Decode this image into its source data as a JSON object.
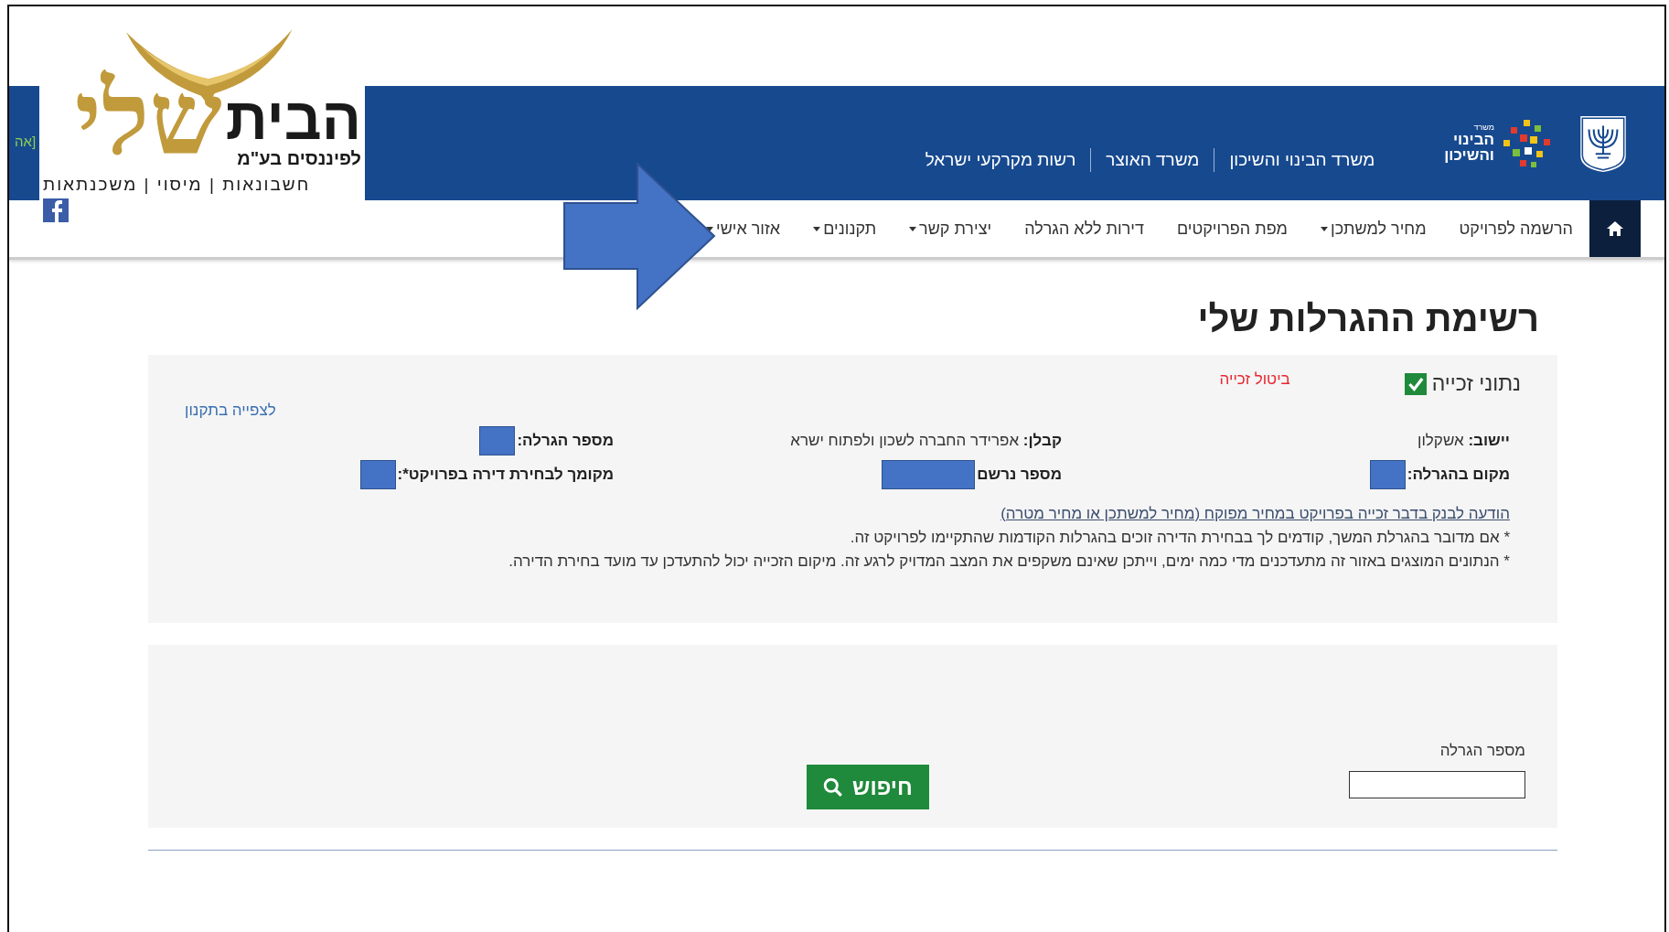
{
  "overlay_logo": {
    "name_main": "הבית",
    "name_gold": "שלי",
    "subtitle": "לפיננסים בע\"מ",
    "tagline": "חשבונאות | מיסוי | משכנתאות"
  },
  "header": {
    "cut_text": "אה]",
    "ministry_logo": [
      "משרד",
      "הבינוי",
      "והשיכון"
    ],
    "links": [
      "משרד הבינוי והשיכון",
      "משרד האוצר",
      "רשות מקרקעי ישראל"
    ]
  },
  "nav": {
    "items": [
      {
        "label": "הרשמה לפרויקט",
        "dropdown": false
      },
      {
        "label": "מחיר למשתכן",
        "dropdown": true
      },
      {
        "label": "מפת הפרויקטים",
        "dropdown": false
      },
      {
        "label": "דירות ללא הגרלה",
        "dropdown": false
      },
      {
        "label": "יצירת קשר",
        "dropdown": true
      },
      {
        "label": "תקנונים",
        "dropdown": true
      },
      {
        "label": "אזור אישי",
        "dropdown": true
      }
    ]
  },
  "page_title": "רשימת ההגרלות שלי",
  "winning": {
    "title": "נתוני זכייה",
    "checked": true,
    "cancel_link": "ביטול זכייה",
    "regulations_link": "לצפייה בתקנון",
    "fields": [
      {
        "label": "יישוב:",
        "value": "אשקלון",
        "kind": "text"
      },
      {
        "label": "קבלן:",
        "value": "אפרידר החברה לשכון ולפתוח ישרא",
        "kind": "text"
      },
      {
        "label": "מספר הגרלה:",
        "kind": "redacted"
      },
      {
        "label": "מקום בהגרלה:",
        "kind": "redacted"
      },
      {
        "label": "מספר נרשם",
        "kind": "redacted-wide"
      },
      {
        "label": "מקומך לבחירת דירה בפרויקט*:",
        "kind": "redacted"
      }
    ],
    "bank_notice_link": "הודעה לבנק בדבר זכייה בפרויקט במחיר מפוקח (מחיר למשתכן או מחיר מטרה)",
    "notes": [
      "* אם מדובר בהגרלת המשך, קודמים לך בבחירת הדירה זוכים בהגרלות הקודמות שהתקיימו לפרויקט זה.",
      "* הנתונים המוצגים באזור זה מתעדכנים מדי כמה ימים, וייתכן שאינם משקפים את המצב המדויק לרגע זה. מיקום הזכייה יכול להתעדכן עד מועד בחירת הדירה."
    ]
  },
  "search": {
    "field_label": "מספר הגרלה",
    "button": "חיפוש"
  }
}
